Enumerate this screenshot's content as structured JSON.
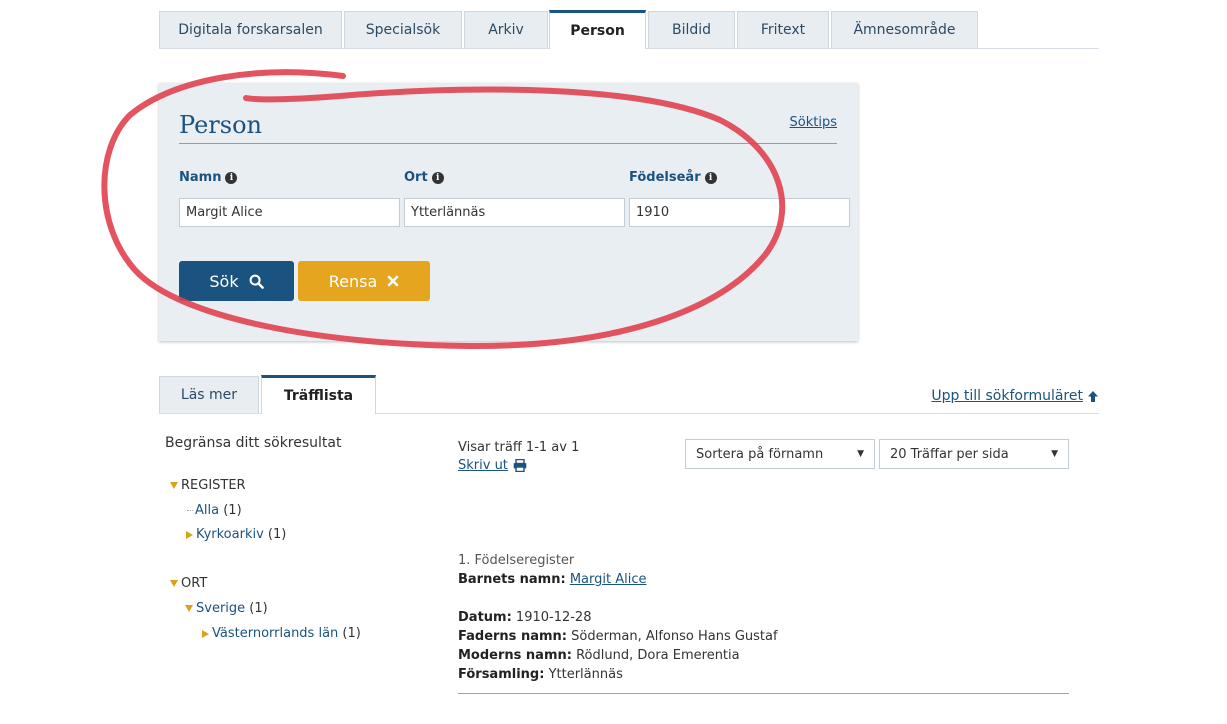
{
  "top_tabs": [
    {
      "label": "Digitala forskarsalen"
    },
    {
      "label": "Specialsök"
    },
    {
      "label": "Arkiv"
    },
    {
      "label": "Person"
    },
    {
      "label": "Bildid"
    },
    {
      "label": "Fritext"
    },
    {
      "label": "Ämnesområde"
    }
  ],
  "panel": {
    "title": "Person",
    "soktips": "Söktips",
    "fields": [
      {
        "label": "Namn",
        "value": "Margit Alice"
      },
      {
        "label": "Ort",
        "value": "Ytterlännäs"
      },
      {
        "label": "Födelseår",
        "value": "1910"
      }
    ],
    "search_button": "Sök",
    "clear_button": "Rensa"
  },
  "result_tabs": [
    {
      "label": "Läs mer"
    },
    {
      "label": "Träfflista"
    }
  ],
  "upp_link": "Upp till sökformuläret",
  "facets": {
    "title": "Begränsa ditt sökresultat",
    "register_label": "REGISTER",
    "alla": {
      "label": "Alla",
      "count": "(1)"
    },
    "kyrkoarkiv": {
      "label": "Kyrkoarkiv",
      "count": "(1)"
    },
    "ort_label": "ORT",
    "sverige": {
      "label": "Sverige",
      "count": "(1)"
    },
    "vasternorrland": {
      "label": "Västernorrlands län",
      "count": "(1)"
    }
  },
  "results": {
    "visar": "Visar träff 1-1 av 1",
    "skriv_ut": "Skriv ut",
    "sort_select": "Sortera på förnamn",
    "per_page_select": "20 Träffar per sida",
    "item_heading": "1. Födelseregister",
    "barnets_label": "Barnets namn:",
    "barnets_value": "Margit Alice",
    "datum_label": "Datum:",
    "datum_value": "1910-12-28",
    "faders_label": "Faderns namn:",
    "faders_value": "Söderman, Alfonso Hans Gustaf",
    "moders_label": "Moderns namn:",
    "moders_value": "Rödlund, Dora Emerentia",
    "forsamling_label": "Församling:",
    "forsamling_value": "Ytterlännäs"
  },
  "colors": {
    "primary": "#1a5380",
    "accent": "#e6a51e",
    "annotation": "#e0414f"
  }
}
